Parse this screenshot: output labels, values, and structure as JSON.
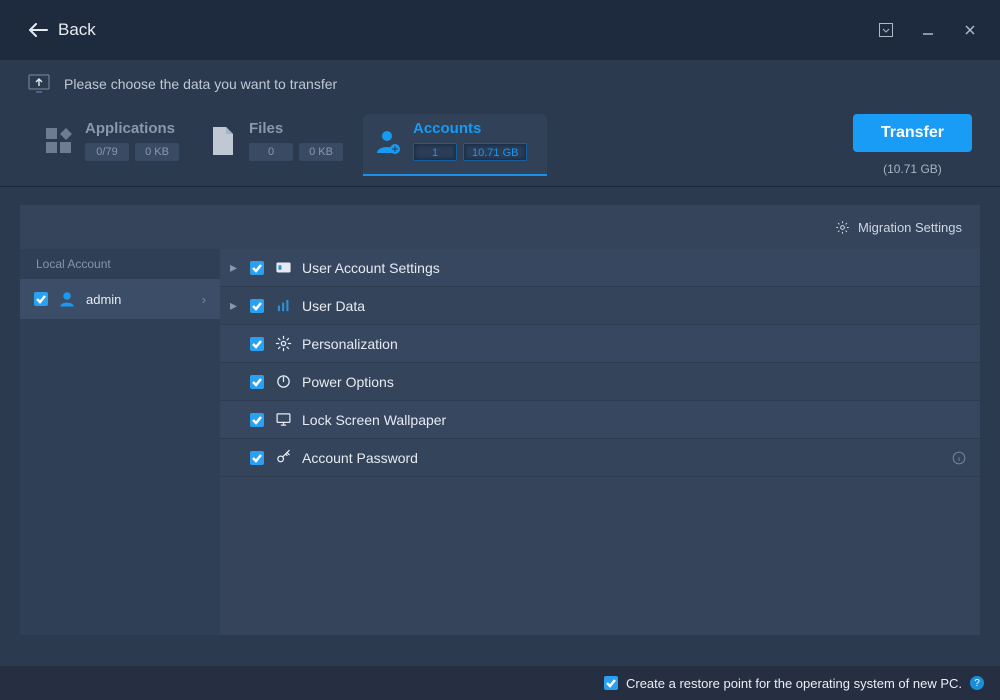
{
  "titlebar": {
    "back_label": "Back"
  },
  "instruction": "Please choose the data you want to transfer",
  "tabs": {
    "applications": {
      "title": "Applications",
      "count": "0/79",
      "size": "0 KB"
    },
    "files": {
      "title": "Files",
      "count": "0",
      "size": "0 KB"
    },
    "accounts": {
      "title": "Accounts",
      "count": "1",
      "size": "10.71 GB"
    }
  },
  "transfer": {
    "button": "Transfer",
    "size": "(10.71 GB)"
  },
  "migration_settings": "Migration Settings",
  "sidebar": {
    "header": "Local Account",
    "items": [
      {
        "name": "admin",
        "checked": true
      }
    ]
  },
  "rows": [
    {
      "label": "User Account Settings",
      "checked": true,
      "expandable": true,
      "icon": "id-card"
    },
    {
      "label": "User Data",
      "checked": true,
      "expandable": true,
      "icon": "bars"
    },
    {
      "label": "Personalization",
      "checked": true,
      "expandable": false,
      "icon": "gear"
    },
    {
      "label": "Power Options",
      "checked": true,
      "expandable": false,
      "icon": "power"
    },
    {
      "label": "Lock Screen Wallpaper",
      "checked": true,
      "expandable": false,
      "icon": "monitor"
    },
    {
      "label": "Account Password",
      "checked": true,
      "expandable": false,
      "icon": "key",
      "info": true
    }
  ],
  "footer": {
    "restore_checked": true,
    "restore_label": "Create a restore point for the operating system of new PC."
  }
}
